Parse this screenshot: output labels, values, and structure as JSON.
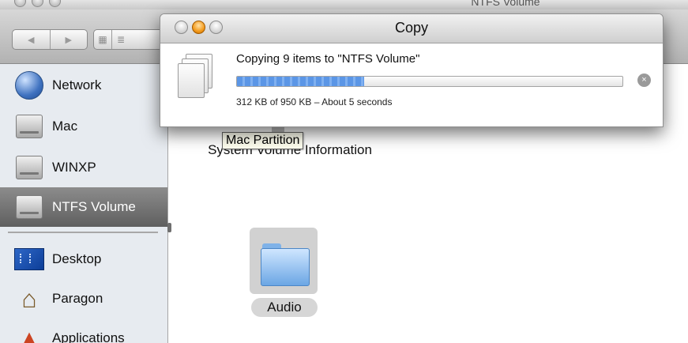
{
  "finder": {
    "window_title": "NTFS Volume",
    "toolbar": {
      "back_glyph": "◀",
      "forward_glyph": "▶",
      "icon_view_glyph": "▦",
      "list_view_glyph": "≣"
    },
    "sidebar": {
      "items": [
        {
          "label": "Network",
          "icon": "network-globe-icon"
        },
        {
          "label": "Mac",
          "icon": "hard-drive-icon"
        },
        {
          "label": "WINXP",
          "icon": "hard-drive-icon"
        },
        {
          "label": "NTFS Volume",
          "icon": "hard-drive-icon",
          "selected": true
        },
        {
          "label": "Desktop",
          "icon": "desktop-icon"
        },
        {
          "label": "Paragon",
          "icon": "home-icon"
        },
        {
          "label": "Applications",
          "icon": "applications-icon"
        }
      ]
    },
    "content": {
      "items": [
        {
          "label": "System Volume Information"
        },
        {
          "label": "Audio"
        }
      ],
      "tooltip": "Mac Partition"
    }
  },
  "copy_dialog": {
    "title": "Copy",
    "message": "Copying 9 items to \"NTFS Volume\"",
    "progress": 0.33,
    "status": "312 KB of 950 KB – About 5 seconds",
    "stop_glyph": "×"
  }
}
